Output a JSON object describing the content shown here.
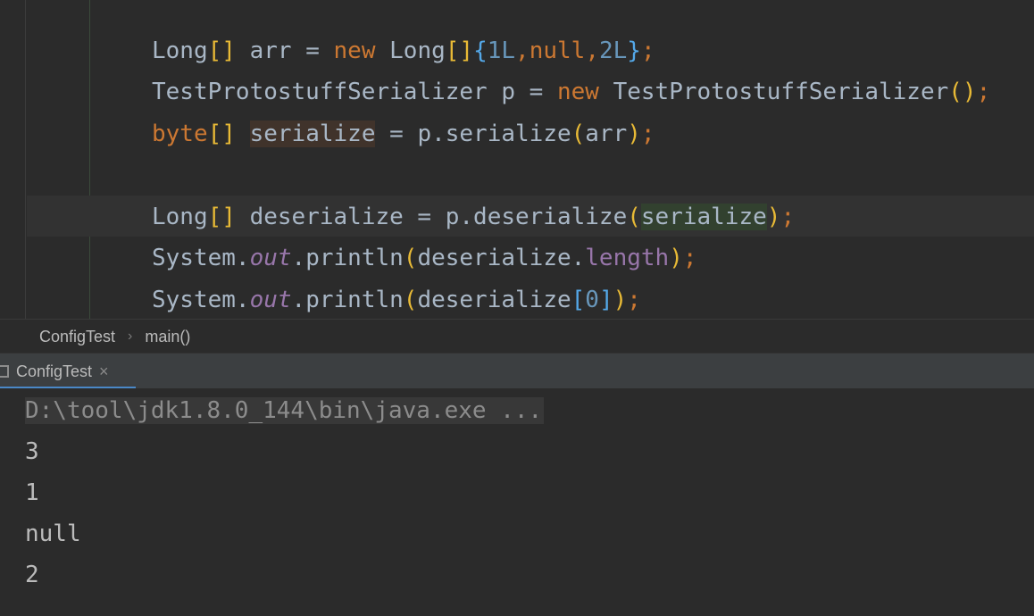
{
  "editor": {
    "line1": {
      "t1": "Long",
      "t2": "[]",
      "t3": " arr = ",
      "t4": "new",
      "t5": " Long",
      "t6": "[]",
      "t7": "{",
      "t8": "1L",
      "t9": ",",
      "t10": "null",
      "t11": ",",
      "t12": "2L",
      "t13": "}",
      "t14": ";"
    },
    "line2": {
      "t1": "TestProtostuffSerializer p = ",
      "t2": "new",
      "t3": " TestProtostuffSerializer",
      "t4": "()",
      "t5": ";"
    },
    "line3": {
      "t1": "byte",
      "t2": "[]",
      "t3": " ",
      "t4": "serialize",
      "t5": " = p.serialize",
      "t6": "(",
      "t7": "arr",
      "t8": ")",
      "t9": ";"
    },
    "line4": {
      "t1": "Long",
      "t2": "[]",
      "t3": " deserialize = p.deserialize",
      "t4": "(",
      "t5": "serialize",
      "t6": ")",
      "t7": ";"
    },
    "line5": {
      "t1": "System.",
      "t2": "out",
      "t3": ".println",
      "t4": "(",
      "t5": "deserialize.",
      "t6": "length",
      "t7": ")",
      "t8": ";"
    },
    "line6": {
      "t1": "System.",
      "t2": "out",
      "t3": ".println",
      "t4": "(",
      "t5": "deserialize",
      "t6": "[",
      "t7": "0",
      "t8": "]",
      "t9": ")",
      "t10": ";"
    }
  },
  "breadcrumb": {
    "class_name": "ConfigTest",
    "separator": "›",
    "method_name": "main()"
  },
  "run_panel": {
    "tab_label": "ConfigTest",
    "close_glyph": "×"
  },
  "console": {
    "command": "D:\\tool\\jdk1.8.0_144\\bin\\java.exe ...",
    "output": [
      "3",
      "1",
      "null",
      "2"
    ]
  },
  "colors": {
    "background": "#2b2b2b",
    "keyword": "#cc7832",
    "bracket": "#e8ba36",
    "number": "#6897bb",
    "field": "#9876aa",
    "text": "#a9b7c6"
  }
}
